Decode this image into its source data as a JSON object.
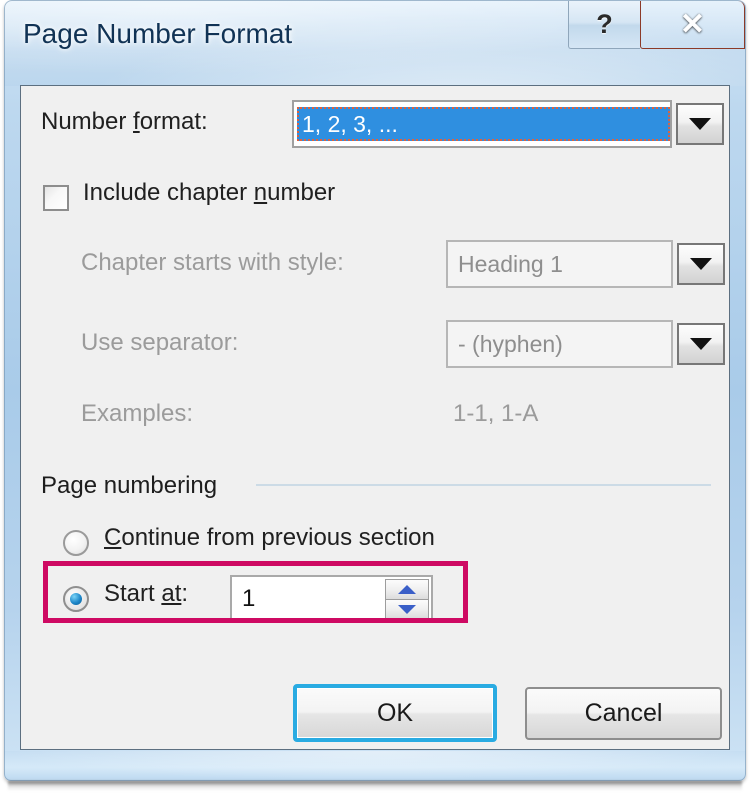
{
  "window": {
    "title": "Page Number Format",
    "caption_buttons": [
      {
        "name": "help-button",
        "glyph": "?"
      },
      {
        "name": "close-button",
        "glyph": "✕"
      }
    ]
  },
  "colors": {
    "frame_glass": "#a9cbe9",
    "dialog_background": "#f0f0f0",
    "selection_blue": "#2f8fe0",
    "focus_dotted": "#e2603a",
    "annotation_magenta": "#ce0a63",
    "default_button_glow": "#29abe2",
    "disabled_text": "#9b9b9b",
    "close_button_red": "#c63f26"
  },
  "fields": {
    "number_format": {
      "label": "Number format:",
      "label_prefix": "Number ",
      "label_accel": "f",
      "label_suffix": "ormat:",
      "value": "1, 2, 3, ...",
      "selected": true,
      "focused": true,
      "enabled": true,
      "dropdown_icon": "chevron-down-icon"
    },
    "include_chapter_number": {
      "label": "Include chapter number",
      "label_prefix": "Include chapter ",
      "label_accel": "n",
      "label_suffix": "umber",
      "checked": false,
      "enabled": true
    },
    "chapter_starts_with_style": {
      "label": "Chapter starts with style:",
      "value": "Heading 1",
      "enabled": false,
      "dropdown_icon": "chevron-down-icon"
    },
    "use_separator": {
      "label": "Use separator:",
      "value": "-   (hyphen)",
      "enabled": false,
      "dropdown_icon": "chevron-down-icon"
    },
    "examples": {
      "label": "Examples:",
      "value": "1-1, 1-A",
      "enabled": false
    }
  },
  "page_numbering": {
    "group_title": "Page numbering",
    "options": [
      {
        "name": "continue-from-previous-section",
        "label": "Continue from previous section",
        "label_accel": "C",
        "label_suffix": "ontinue from previous section",
        "selected": false
      },
      {
        "name": "start-at",
        "label": "Start at:",
        "label_prefix": "Start ",
        "label_accel": "at",
        "label_suffix": ":",
        "selected": true
      }
    ],
    "start_at_value": "1",
    "spinner": {
      "up_icon": "triangle-up-icon",
      "down_icon": "triangle-down-icon"
    },
    "highlighted": true
  },
  "footer": {
    "ok_label": "OK",
    "cancel_label": "Cancel",
    "ok_is_default": true
  }
}
